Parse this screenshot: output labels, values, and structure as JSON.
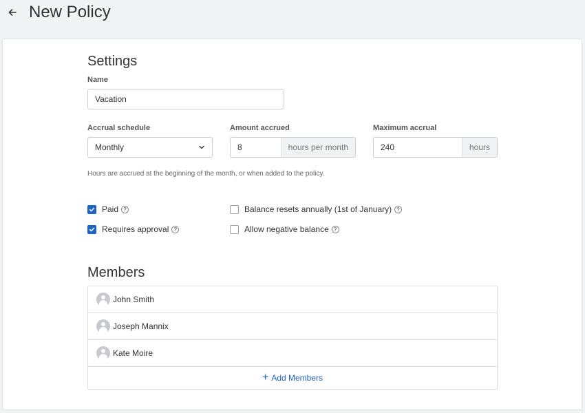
{
  "header": {
    "title": "New Policy"
  },
  "settings": {
    "title": "Settings",
    "name_label": "Name",
    "name_value": "Vacation",
    "accrual_schedule_label": "Accrual schedule",
    "accrual_schedule_value": "Monthly",
    "amount_accrued_label": "Amount accrued",
    "amount_accrued_value": "8",
    "amount_accrued_suffix": "hours per month",
    "max_accrual_label": "Maximum accrual",
    "max_accrual_value": "240",
    "max_accrual_suffix": "hours",
    "helper": "Hours are accrued at the beginning of the month, or when added to the policy."
  },
  "options": {
    "paid": {
      "label": "Paid",
      "checked": true
    },
    "requires_approval": {
      "label": "Requires approval",
      "checked": true
    },
    "balance_resets": {
      "label": "Balance resets annually (1st of January)",
      "checked": false
    },
    "allow_negative": {
      "label": "Allow negative balance",
      "checked": false
    }
  },
  "members": {
    "title": "Members",
    "items": [
      {
        "name": "John Smith"
      },
      {
        "name": "Joseph Mannix"
      },
      {
        "name": "Kate Moire"
      }
    ],
    "add_label": "Add Members"
  },
  "colors": {
    "accent": "#1e62c4",
    "border": "#dcdfe4",
    "page_bg": "#f2f3f5"
  },
  "icons": {
    "back": "arrow-left-icon",
    "help": "help-circle-icon",
    "dropdown": "chevron-down-icon",
    "avatar": "user-avatar-icon",
    "add": "plus-icon"
  }
}
